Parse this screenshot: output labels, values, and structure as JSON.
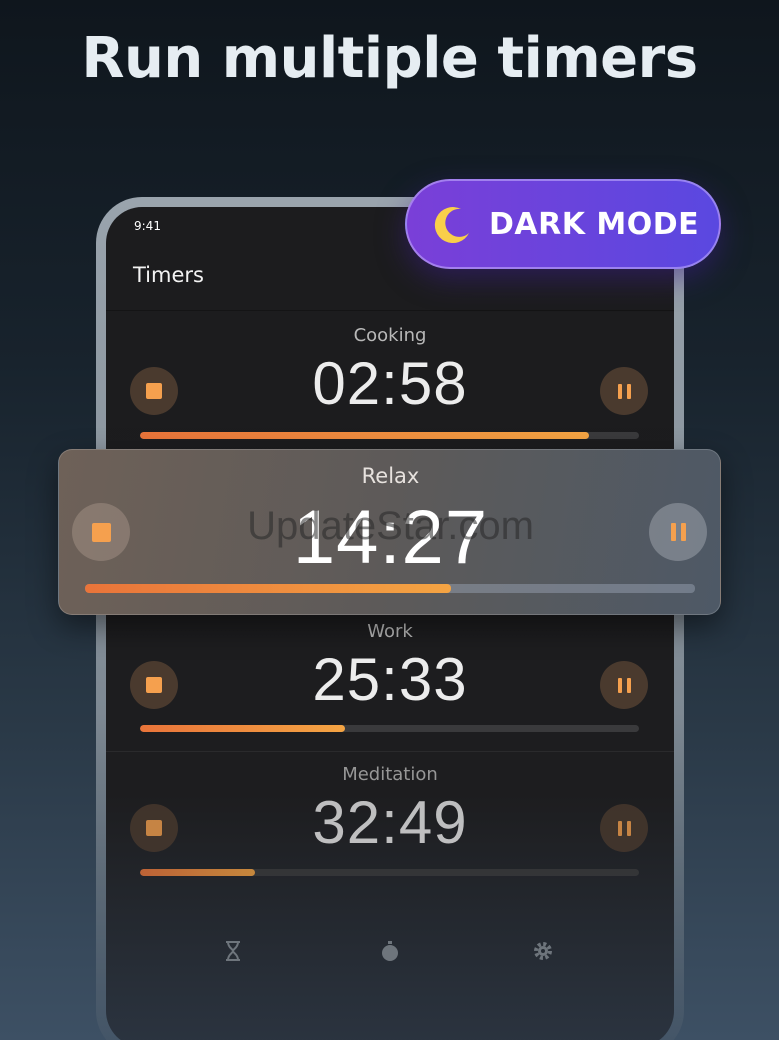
{
  "headline": "Run multiple timers",
  "badge": {
    "text": "DARK MODE",
    "icon": "moon-icon"
  },
  "status_bar": {
    "time": "9:41"
  },
  "app": {
    "title": "Timers"
  },
  "timers": [
    {
      "label": "Cooking",
      "time": "02:58",
      "progress": 0.9
    },
    {
      "label": "Relax",
      "time": "14:27",
      "progress": 0.6
    },
    {
      "label": "Work",
      "time": "25:33",
      "progress": 0.41
    },
    {
      "label": "Meditation",
      "time": "32:49",
      "progress": 0.23
    }
  ],
  "watermark": "UpdateStar.com",
  "bottom_nav": [
    "hourglass-icon",
    "stopwatch-icon",
    "gear-icon"
  ],
  "colors": {
    "accent": "#f5a04e",
    "badge": "#6a45dc"
  }
}
